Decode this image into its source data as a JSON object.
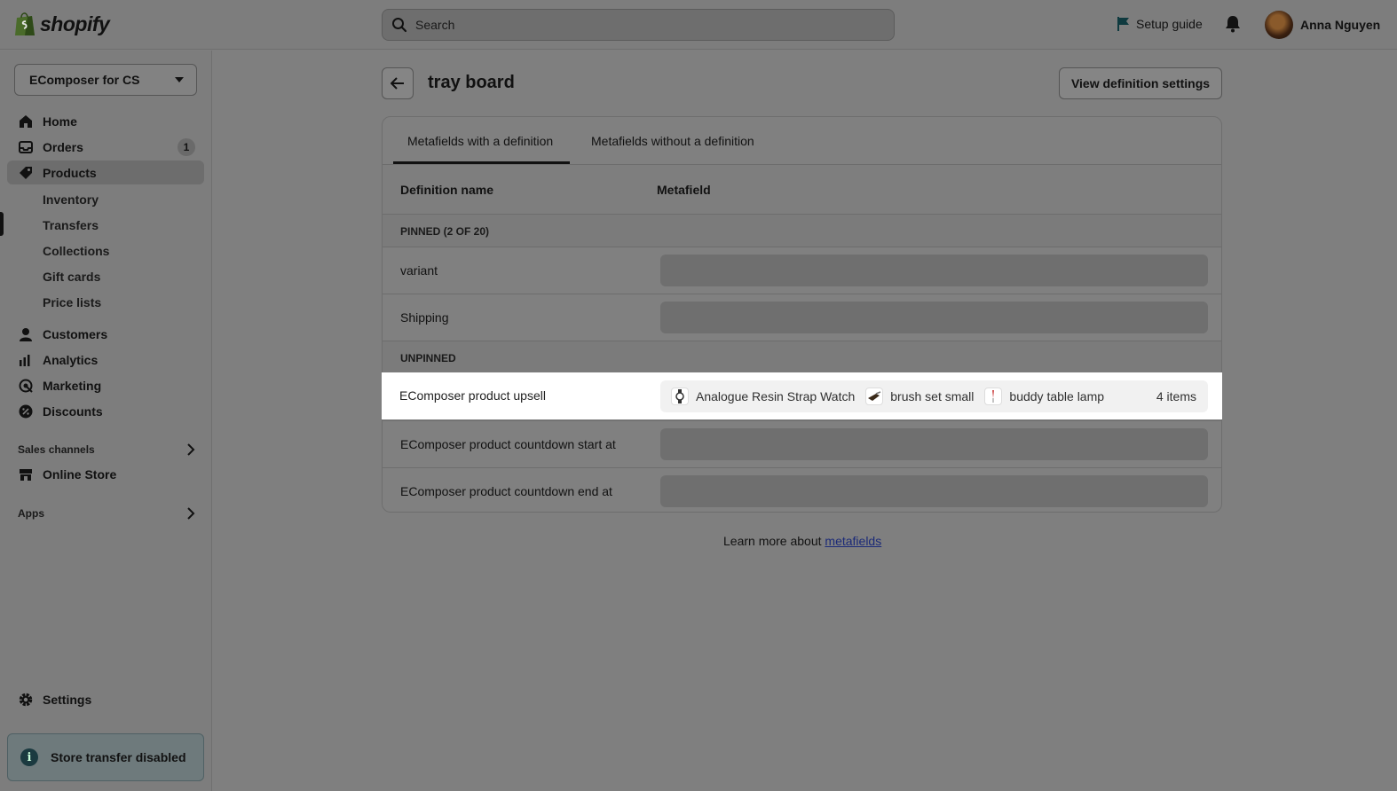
{
  "topbar": {
    "logo_text": "shopify",
    "search_placeholder": "Search",
    "setup_guide": "Setup guide",
    "user_name": "Anna Nguyen"
  },
  "sidebar": {
    "store_name": "EComposer for CS",
    "items": [
      {
        "label": "Home",
        "icon": "home-icon"
      },
      {
        "label": "Orders",
        "icon": "inbox-icon",
        "badge": "1"
      },
      {
        "label": "Products",
        "icon": "tag-icon",
        "active": true
      }
    ],
    "product_subitems": [
      "Inventory",
      "Transfers",
      "Collections",
      "Gift cards",
      "Price lists"
    ],
    "items2": [
      {
        "label": "Customers",
        "icon": "person-icon"
      },
      {
        "label": "Analytics",
        "icon": "bar-chart-icon"
      },
      {
        "label": "Marketing",
        "icon": "target-icon"
      },
      {
        "label": "Discounts",
        "icon": "discount-icon"
      }
    ],
    "sales_channels": "Sales channels",
    "online_store": "Online Store",
    "apps": "Apps",
    "settings": "Settings",
    "transfer_notice": "Store transfer disabled"
  },
  "page": {
    "title": "tray board",
    "view_button": "View definition settings",
    "tabs": [
      "Metafields with a definition",
      "Metafields without a definition"
    ],
    "col_name": "Definition name",
    "col_metafield": "Metafield",
    "pinned_label": "PINNED (2 OF 20)",
    "pinned_rows": [
      "variant",
      "Shipping"
    ],
    "unpinned_label": "UNPINNED",
    "upsell": {
      "label": "EComposer product upsell",
      "items": [
        "Analogue Resin Strap Watch",
        "brush set small",
        "buddy table lamp"
      ],
      "count": "4 items"
    },
    "unpinned_rows": [
      "EComposer product countdown start at",
      "EComposer product countdown end at"
    ],
    "learn_more_prefix": "Learn more about ",
    "learn_more_link": "metafields"
  }
}
